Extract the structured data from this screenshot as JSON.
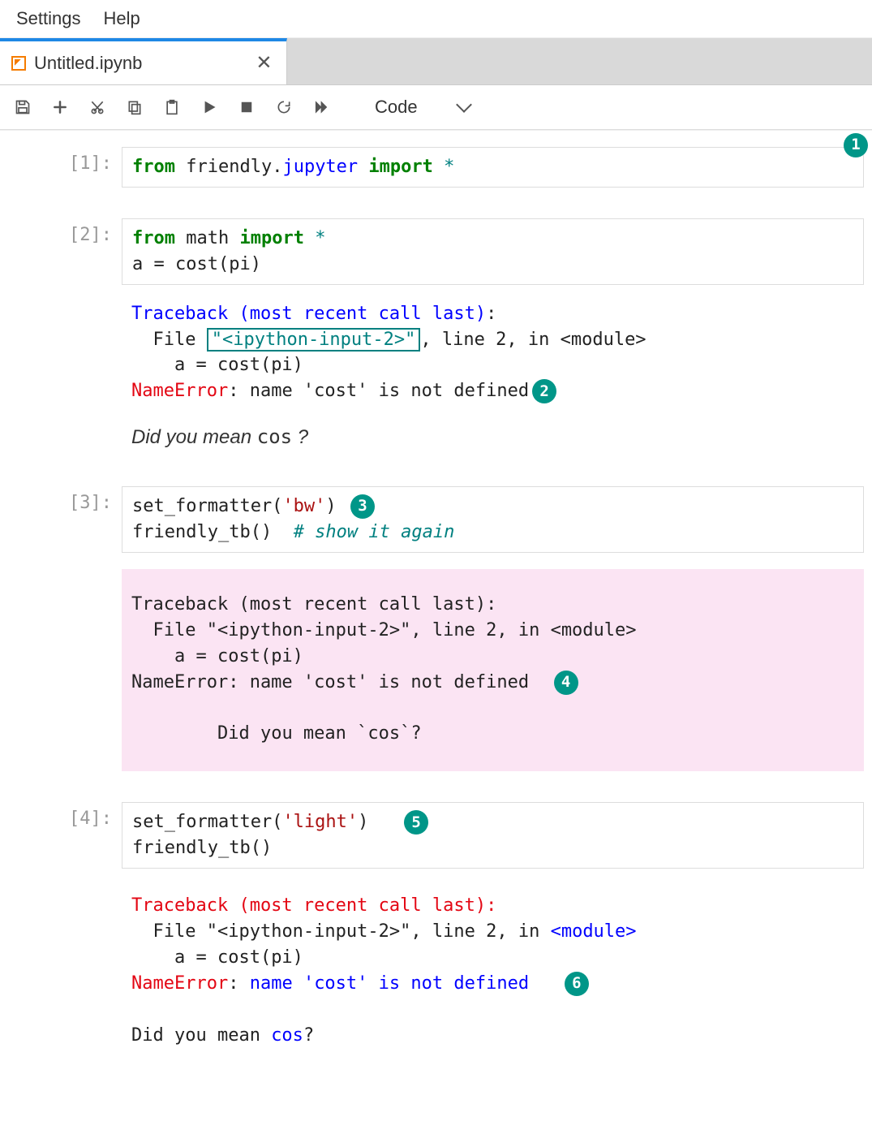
{
  "menubar": {
    "settings": "Settings",
    "help": "Help"
  },
  "tab": {
    "title": "Untitled.ipynb",
    "close": "✕"
  },
  "toolbar": {
    "celltype": "Code"
  },
  "badges": {
    "b1": "1",
    "b2": "2",
    "b3": "3",
    "b4": "4",
    "b5": "5",
    "b6": "6"
  },
  "cells": {
    "c1": {
      "prompt": "[1]:",
      "from": "from",
      "friendly": "friendly",
      "jupyter": "jupyter",
      "import": "import",
      "star": "*"
    },
    "c2": {
      "prompt": "[2]:",
      "from": "from",
      "math": "math",
      "import": "import",
      "star": "*",
      "line2": "a = cost(pi)",
      "tb_header": "Traceback (most recent call last)",
      "tb_file_pre": "  File ",
      "tb_file_box": "\"<ipython-input-2>\"",
      "tb_file_post": ", line 2, in <module>",
      "tb_code": "    a = cost(pi)",
      "tb_err": "NameError",
      "tb_err_msg": ": name 'cost' is not defined",
      "didmean_pre": "Did you mean ",
      "didmean_cos": "cos",
      "didmean_q": " ?"
    },
    "c3": {
      "prompt": "[3]:",
      "fn1": "set_formatter(",
      "arg1": "'bw'",
      "close1": ")",
      "fn2": "friendly_tb()  ",
      "comment": "# show it again",
      "out_tb": "Traceback (most recent call last):\n  File \"<ipython-input-2>\", line 2, in <module>\n    a = cost(pi)\nNameError: name 'cost' is not defined",
      "out_didmean": "        Did you mean `cos`?"
    },
    "c4": {
      "prompt": "[4]:",
      "fn1": "set_formatter(",
      "arg1": "'light'",
      "close1": ")",
      "fn2": "friendly_tb()",
      "tb_header": "Traceback (most recent call last):",
      "tb_file": "  File \"<ipython-input-2>\", line 2, in ",
      "tb_module": "<module>",
      "tb_code": "    a = cost(pi)",
      "tb_err": "NameError",
      "tb_err_msg_pre": ": ",
      "tb_err_msg": "name 'cost' is not defined",
      "didmean_pre": "Did you mean ",
      "didmean_cos": "cos",
      "didmean_q": "?"
    }
  }
}
